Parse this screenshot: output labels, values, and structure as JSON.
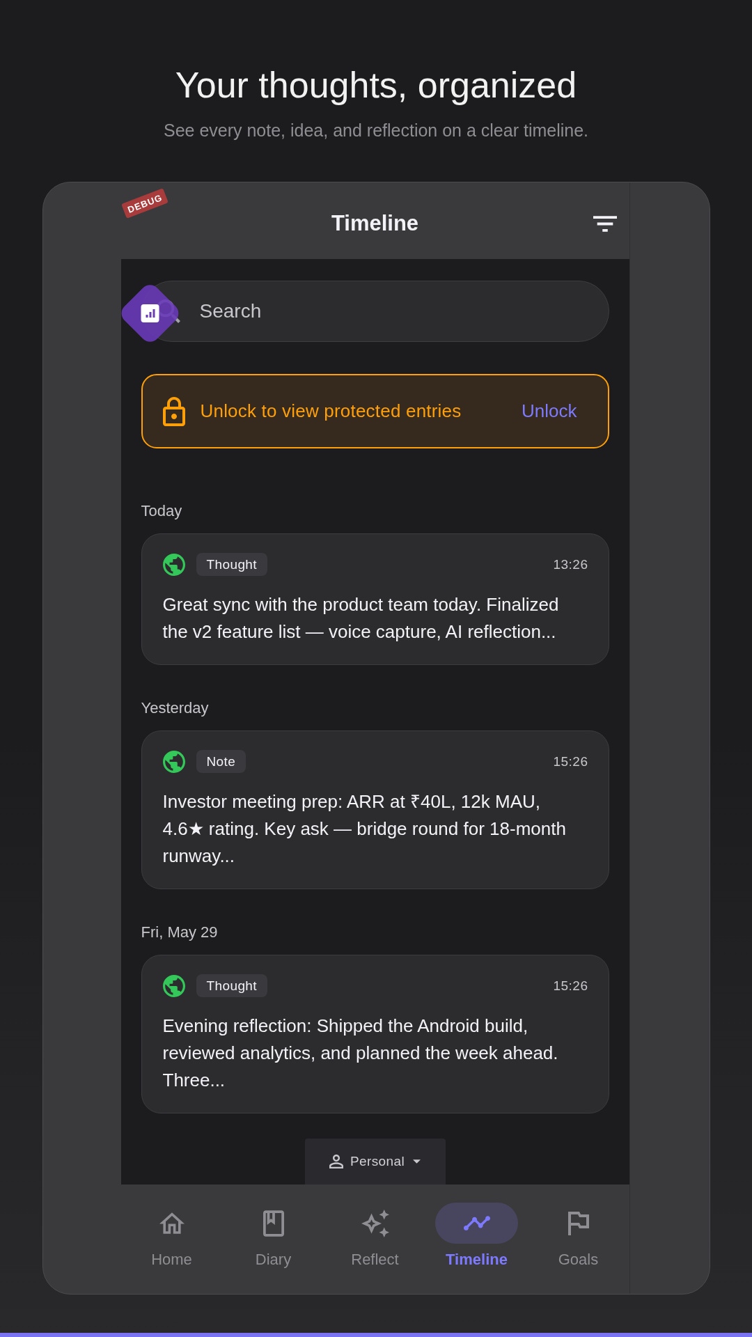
{
  "page_header": {
    "title": "Your thoughts, organized",
    "subtitle": "See every note, idea, and reflection on a clear timeline."
  },
  "debug_banner": "DEBUG",
  "app_bar": {
    "title": "Timeline"
  },
  "search": {
    "placeholder": "Search"
  },
  "lock_banner": {
    "message": "Unlock to view protected entries",
    "action": "Unlock"
  },
  "timeline": [
    {
      "date": "Today",
      "entries": [
        {
          "tag": "Thought",
          "time": "13:26",
          "text": "Great sync with the product team today. Finalized the v2 feature list — voice capture, AI reflection..."
        }
      ]
    },
    {
      "date": "Yesterday",
      "entries": [
        {
          "tag": "Note",
          "time": "15:26",
          "text": "Investor meeting prep: ARR at ₹40L, 12k MAU, 4.6★ rating. Key ask — bridge round for 18-month runway..."
        }
      ]
    },
    {
      "date": "Fri, May 29",
      "entries": [
        {
          "tag": "Thought",
          "time": "15:26",
          "text": "Evening reflection: Shipped the Android build, reviewed analytics, and planned the week ahead. Three..."
        }
      ]
    }
  ],
  "space_selector": {
    "label": "Personal"
  },
  "nav": {
    "items": [
      {
        "label": "Home",
        "selected": false
      },
      {
        "label": "Diary",
        "selected": false
      },
      {
        "label": "Reflect",
        "selected": false
      },
      {
        "label": "Timeline",
        "selected": true
      },
      {
        "label": "Goals",
        "selected": false
      }
    ]
  }
}
